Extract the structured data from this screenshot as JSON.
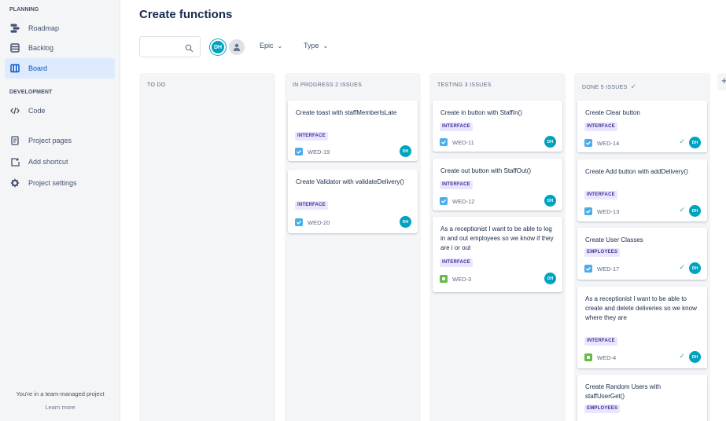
{
  "sidebar": {
    "planning_heading": "PLANNING",
    "development_heading": "DEVELOPMENT",
    "items": [
      {
        "label": "Roadmap",
        "icon": "roadmap-icon"
      },
      {
        "label": "Backlog",
        "icon": "backlog-icon"
      },
      {
        "label": "Board",
        "icon": "board-icon",
        "active": true
      },
      {
        "label": "Code",
        "icon": "code-icon"
      },
      {
        "label": "Project pages",
        "icon": "pages-icon"
      },
      {
        "label": "Add shortcut",
        "icon": "add-shortcut-icon"
      },
      {
        "label": "Project settings",
        "icon": "gear-icon"
      }
    ],
    "footer_text": "You're in a team-managed project",
    "footer_link": "Learn more"
  },
  "header": {
    "title": "Create functions",
    "search_placeholder": "",
    "user_initials": "DH",
    "filter_epic": "Epic",
    "filter_type": "Type"
  },
  "columns": [
    {
      "heading": "TO DO",
      "cards": []
    },
    {
      "heading": "IN PROGRESS 2 ISSUES",
      "cards": [
        {
          "title": "Create toast with staffMemberIsLate",
          "label": "INTERFACE",
          "key": "WED-19",
          "type": "task",
          "assignee": "DH"
        },
        {
          "title": "Create Validator with validateDelivery()",
          "label": "INTERFACE",
          "key": "WED-20",
          "type": "task",
          "assignee": "DH"
        }
      ]
    },
    {
      "heading": "TESTING 3 ISSUES",
      "cards": [
        {
          "title": "Create in button with StaffIn()",
          "label": "INTERFACE",
          "key": "WED-11",
          "type": "task",
          "assignee": "DH"
        },
        {
          "title": "Create out button with StaffOut()",
          "label": "INTERFACE",
          "key": "WED-12",
          "type": "task",
          "assignee": "DH"
        },
        {
          "title": "As a receptionist I want to be able to log in and out employees so we know if they are i or out",
          "label": "INTERFACE",
          "key": "WED-3",
          "type": "story",
          "assignee": "DH"
        }
      ]
    },
    {
      "heading": "DONE 5 ISSUES",
      "cards": [
        {
          "title": "Create Clear button",
          "label": "INTERFACE",
          "key": "WED-14",
          "type": "task",
          "assignee": "DH",
          "done": true
        },
        {
          "title": "Create Add button with addDelivery()",
          "label": "INTERFACE",
          "key": "WED-13",
          "type": "task",
          "assignee": "DH",
          "done": true
        },
        {
          "title": "Create User Classes",
          "label": "EMPLOYEES",
          "key": "WED-17",
          "type": "task",
          "assignee": "DH",
          "done": true
        },
        {
          "title": "As a receptionist I want to be able to create and delete deliveries so we know where they are",
          "label": "INTERFACE",
          "key": "WED-4",
          "type": "story",
          "assignee": "DH",
          "done": true
        },
        {
          "title": "Create Random Users with staffUserGet()",
          "label": "EMPLOYEES",
          "key": "",
          "type": "task",
          "assignee": "",
          "done": false
        }
      ]
    }
  ],
  "colors": {
    "accent": "#0052cc",
    "avatar": "#00a3bf",
    "label_bg": "#eae6ff",
    "label_fg": "#403294",
    "done": "#36b37e"
  }
}
